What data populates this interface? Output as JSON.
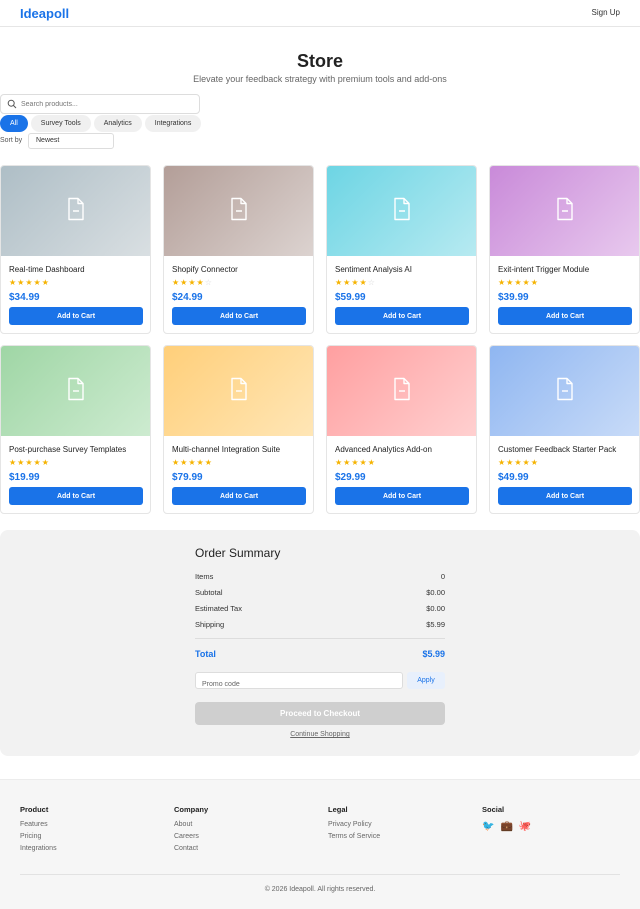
{
  "header": {
    "brand": "Ideapoll",
    "signup_label": "Sign Up"
  },
  "hero": {
    "title": "Store",
    "subtitle": "Elevate your feedback strategy with premium tools and add-ons"
  },
  "search": {
    "placeholder": "Search products..."
  },
  "filters": [
    {
      "label": "All",
      "active": true
    },
    {
      "label": "Survey Tools",
      "active": false
    },
    {
      "label": "Analytics",
      "active": false
    },
    {
      "label": "Integrations",
      "active": false
    }
  ],
  "sort": {
    "label": "Sort by",
    "selected": "Newest"
  },
  "products": [
    {
      "name": "Real-time Dashboard",
      "price": "$34.99",
      "rating": 5,
      "gradient": [
        "#aebec6",
        "#d9dfe2"
      ],
      "button": "Add to Cart"
    },
    {
      "name": "Shopify Connector",
      "price": "$24.99",
      "rating": 4,
      "gradient": [
        "#b39e98",
        "#dcd3d0"
      ],
      "button": "Add to Cart"
    },
    {
      "name": "Sentiment Analysis AI",
      "price": "$59.99",
      "rating": 4,
      "gradient": [
        "#6dd5e4",
        "#b7eaf1"
      ],
      "button": "Add to Cart"
    },
    {
      "name": "Exit-intent Trigger Module",
      "price": "$39.99",
      "rating": 5,
      "gradient": [
        "#c98ad9",
        "#e8c9ee"
      ],
      "button": "Add to Cart"
    },
    {
      "name": "Post-purchase Survey Templates",
      "price": "$19.99",
      "rating": 5,
      "gradient": [
        "#9fd6a5",
        "#cdebd0"
      ],
      "button": "Add to Cart"
    },
    {
      "name": "Multi-channel Integration Suite",
      "price": "$79.99",
      "rating": 5,
      "gradient": [
        "#ffcf7a",
        "#ffe6b6"
      ],
      "button": "Add to Cart"
    },
    {
      "name": "Advanced Analytics Add-on",
      "price": "$29.99",
      "rating": 5,
      "gradient": [
        "#ff9fa0",
        "#ffd0d0"
      ],
      "button": "Add to Cart"
    },
    {
      "name": "Customer Feedback Starter Pack",
      "price": "$49.99",
      "rating": 5,
      "gradient": [
        "#8fb6f1",
        "#c8dbf8"
      ],
      "button": "Add to Cart"
    }
  ],
  "summary": {
    "title": "Order Summary",
    "items_label": "Items",
    "items_value": "0",
    "subtotal_label": "Subtotal",
    "subtotal_value": "$0.00",
    "tax_label": "Estimated Tax",
    "tax_value": "$0.00",
    "shipping_label": "Shipping",
    "shipping_value": "$5.99",
    "total_label": "Total",
    "total_value": "$5.99",
    "promo_placeholder": "Promo code",
    "apply_label": "Apply",
    "checkout_label": "Proceed to Checkout",
    "continue_label": "Continue Shopping"
  },
  "footer": {
    "product": {
      "heading": "Product",
      "links": [
        "Features",
        "Pricing",
        "Integrations"
      ]
    },
    "company": {
      "heading": "Company",
      "links": [
        "About",
        "Careers",
        "Contact"
      ]
    },
    "legal": {
      "heading": "Legal",
      "links": [
        "Privacy Policy",
        "Terms of Service"
      ]
    },
    "social": {
      "heading": "Social",
      "icons": [
        {
          "name": "twitter-icon",
          "glyph": "🐦"
        },
        {
          "name": "briefcase-icon",
          "glyph": "💼"
        },
        {
          "name": "octopus-icon",
          "glyph": "🐙"
        }
      ]
    },
    "copyright": "© 2026 Ideapoll. All rights reserved."
  },
  "colors": {
    "accent": "#1a73e8",
    "star": "#f5b301"
  }
}
